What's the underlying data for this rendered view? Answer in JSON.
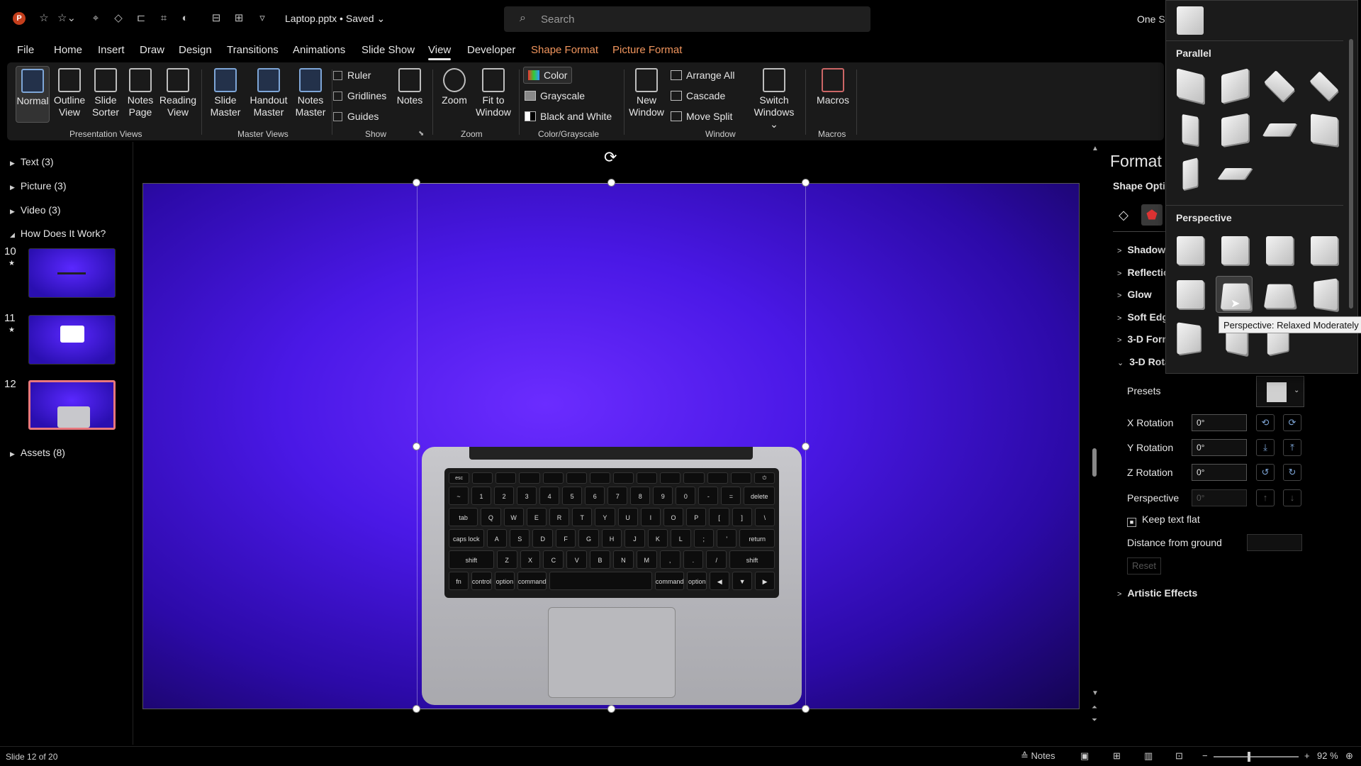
{
  "titlebar": {
    "logo": "P",
    "doc_title": "Laptop.pptx • Saved ⌄",
    "search_placeholder": "Search",
    "user": "One Sk"
  },
  "menu": {
    "tabs": [
      "File",
      "Home",
      "Insert",
      "Draw",
      "Design",
      "Transitions",
      "Animations",
      "Slide Show",
      "View",
      "Developer",
      "Shape Format",
      "Picture Format"
    ],
    "active": "View"
  },
  "ribbon": {
    "normal": "Normal",
    "outline_view": [
      "Outline",
      "View"
    ],
    "slide_sorter": [
      "Slide",
      "Sorter"
    ],
    "notes_page": [
      "Notes",
      "Page"
    ],
    "reading_view": [
      "Reading",
      "View"
    ],
    "presentation_views": "Presentation Views",
    "slide_master": [
      "Slide",
      "Master"
    ],
    "handout_master": [
      "Handout",
      "Master"
    ],
    "notes_master": [
      "Notes",
      "Master"
    ],
    "master_views": "Master Views",
    "ruler": "Ruler",
    "gridlines": "Gridlines",
    "guides": "Guides",
    "notes": "Notes",
    "show": "Show",
    "zoom": "Zoom",
    "fit_to_window": [
      "Fit to",
      "Window"
    ],
    "zoom_group": "Zoom",
    "color": "Color",
    "grayscale": "Grayscale",
    "black_and_white": "Black and White",
    "color_grayscale": "Color/Grayscale",
    "new_window": [
      "New",
      "Window"
    ],
    "arrange_all": "Arrange All",
    "cascade": "Cascade",
    "move_split": "Move Split",
    "switch_windows": [
      "Switch",
      "Windows ⌄"
    ],
    "window": "Window",
    "macros": "Macros",
    "macros_group": "Macros"
  },
  "left_panel": {
    "sections": [
      "Text (3)",
      "Picture (3)",
      "Video (3)",
      "How Does It Work?"
    ],
    "slides": [
      {
        "num": "10",
        "star": "★"
      },
      {
        "num": "11",
        "star": "★"
      },
      {
        "num": "12",
        "star": ""
      }
    ],
    "assets": "Assets (8)"
  },
  "format_pane": {
    "title": "Format",
    "shape_options": "Shape Opti",
    "sections": [
      "Shadow",
      "Reflectio",
      "Glow",
      "Soft Edg",
      "3-D Form",
      "3-D Rota"
    ],
    "presets": "Presets",
    "x_rotation": {
      "label": "X Rotation",
      "value": "0°"
    },
    "y_rotation": {
      "label": "Y Rotation",
      "value": "0°"
    },
    "z_rotation": {
      "label": "Z Rotation",
      "value": "0°"
    },
    "perspective": {
      "label": "Perspective",
      "value": "0°"
    },
    "keep_text_flat": "Keep text flat",
    "distance_from_ground": "Distance from ground",
    "reset": "Reset",
    "artistic_effects": "Artistic Effects"
  },
  "gallery": {
    "parallel": "Parallel",
    "perspective": "Perspective",
    "tooltip": "Perspective: Relaxed Moderately"
  },
  "status": {
    "slide_counter": "Slide 12 of 20",
    "notes": "Notes",
    "zoom": "92 %"
  },
  "colors": {
    "accent_orange": "#f0955d",
    "slide_purple": "#4a18e6",
    "selected_thumb_border": "#e8777d"
  }
}
